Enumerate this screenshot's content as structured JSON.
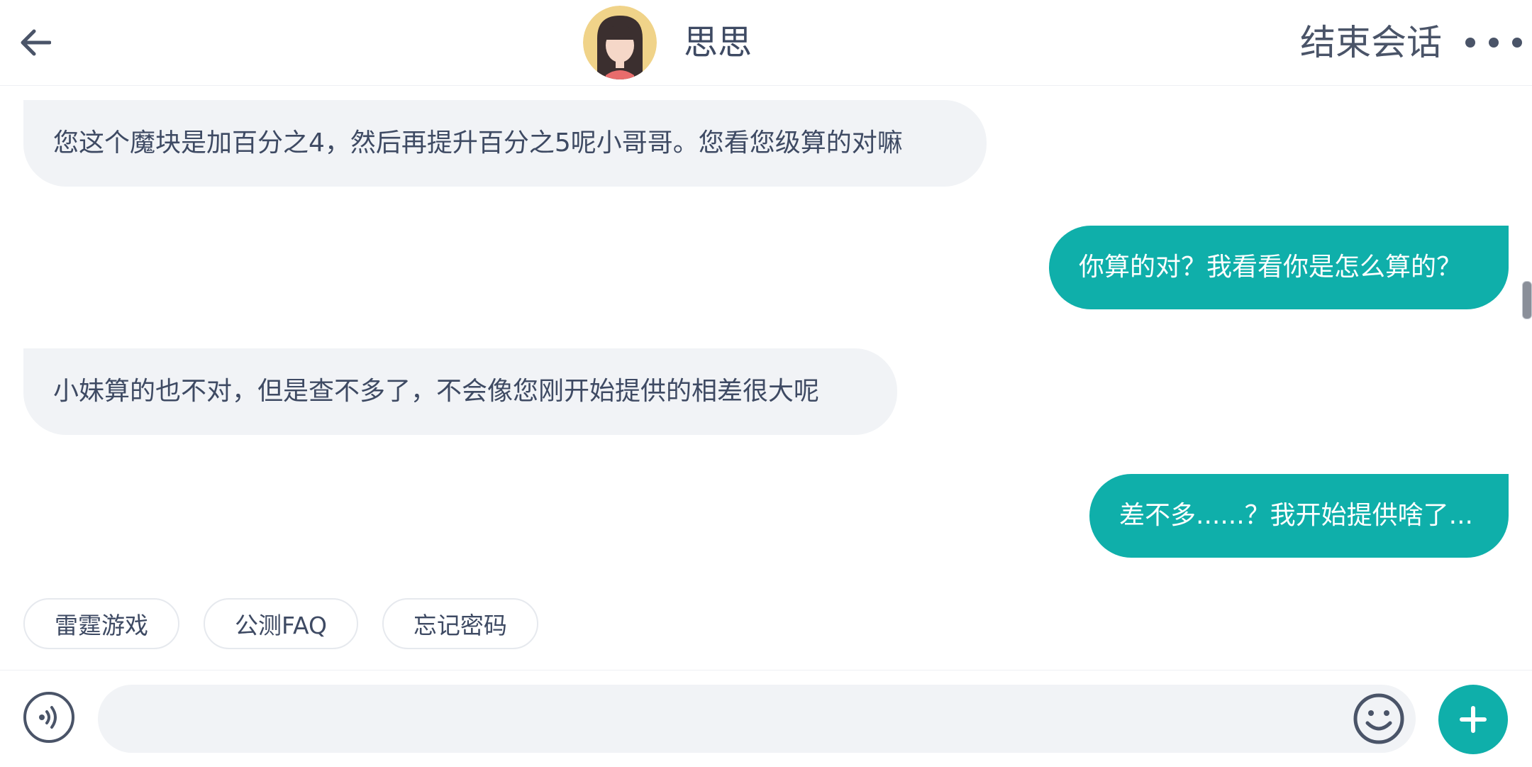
{
  "header": {
    "agent_name": "思思",
    "end_chat_label": "结束会话"
  },
  "messages": [
    {
      "side": "in",
      "text": "您这个魔块是加百分之4，然后再提升百分之5呢小哥哥。您看您级算的对嘛"
    },
    {
      "side": "out",
      "text": "你算的对？我看看你是怎么算的？"
    },
    {
      "side": "in",
      "text": "小妹算的也不对，但是查不多了，不会像您刚开始提供的相差很大呢"
    },
    {
      "side": "out",
      "text": "差不多......？我开始提供啥了..."
    }
  ],
  "quick_replies": [
    "雷霆游戏",
    "公测FAQ",
    "忘记密码"
  ],
  "input": {
    "value": "",
    "placeholder": ""
  },
  "colors": {
    "accent": "#0fafaa",
    "incoming_bubble": "#f1f3f6",
    "text": "#3e4a63"
  },
  "icons": [
    "back-arrow-icon",
    "avatar",
    "more-dots-icon",
    "voice-icon",
    "emoji-icon",
    "plus-icon"
  ]
}
